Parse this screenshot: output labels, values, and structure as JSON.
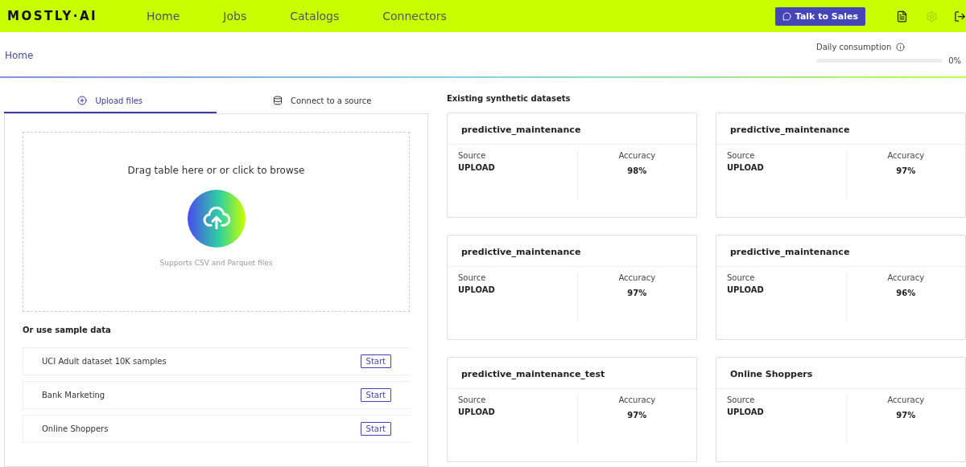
{
  "header": {
    "logo": "MOSTLY·AI",
    "nav": [
      {
        "label": "Home"
      },
      {
        "label": "Jobs"
      },
      {
        "label": "Catalogs"
      },
      {
        "label": "Connectors"
      }
    ],
    "cta": "Talk to Sales"
  },
  "breadcrumb": "Home",
  "consumption": {
    "label": "Daily consumption",
    "level": 0,
    "reading": "0%"
  },
  "tabs": [
    {
      "label": "Upload files",
      "kind": "upload",
      "selected": true
    },
    {
      "label": "Connect to a source",
      "kind": "source",
      "selected": false
    }
  ],
  "dropzone": {
    "title": "Drag table here or or click to browse",
    "hint": "Supports CSV and Parquet files"
  },
  "samples": {
    "title": "Or use sample data",
    "items": [
      {
        "name": "UCI Adult dataset 10K samples",
        "action": "Start"
      },
      {
        "name": "Bank Marketing",
        "action": "Start"
      },
      {
        "name": "Online Shoppers",
        "action": "Start"
      }
    ]
  },
  "datasets": {
    "title": "Existing synthetic datasets",
    "items": [
      {
        "name": "predictive_maintenance",
        "source_label": "Source",
        "source": "UPLOAD",
        "accuracy_label": "Accuracy",
        "accuracy": "98%"
      },
      {
        "name": "predictive_maintenance",
        "source_label": "Source",
        "source": "UPLOAD",
        "accuracy_label": "Accuracy",
        "accuracy": "97%"
      },
      {
        "name": "predictive_maintenance",
        "source_label": "Source",
        "source": "UPLOAD",
        "accuracy_label": "Accuracy",
        "accuracy": "97%"
      },
      {
        "name": "predictive_maintenance",
        "source_label": "Source",
        "source": "UPLOAD",
        "accuracy_label": "Accuracy",
        "accuracy": "96%"
      },
      {
        "name": "predictive_maintenance_test",
        "source_label": "Source",
        "source": "UPLOAD",
        "accuracy_label": "Accuracy",
        "accuracy": "97%"
      },
      {
        "name": "Online Shoppers",
        "source_label": "Source",
        "source": "UPLOAD",
        "accuracy_label": "Accuracy",
        "accuracy": "97%"
      }
    ]
  }
}
